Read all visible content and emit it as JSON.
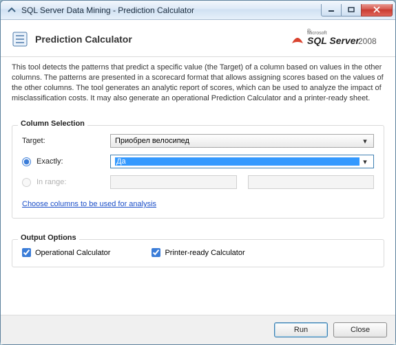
{
  "window": {
    "title": "SQL Server Data Mining - Prediction Calculator"
  },
  "header": {
    "title": "Prediction Calculator",
    "brand_prefix": "Microsoft",
    "brand_main": "SQL Server",
    "brand_year": "2008"
  },
  "description": "This tool detects the patterns that predict a specific value (the Target) of a column based on values in the other columns. The patterns are presented in a scorecard format that allows assigning scores based on the values of the other columns. The tool generates an analytic report of scores, which can be used to analyze the impact of misclassification costs. It may also generate an operational Prediction Calculator and a printer-ready sheet.",
  "column_selection": {
    "legend": "Column Selection",
    "target_label": "Target:",
    "target_value": "Приобрел велосипед",
    "exactly_label": "Exactly:",
    "exactly_value": "Да",
    "exactly_selected": true,
    "in_range_label": "In range:",
    "in_range_selected": false,
    "in_range_enabled": false,
    "choose_columns_link": "Choose columns to be used for analysis"
  },
  "output_options": {
    "legend": "Output Options",
    "operational_label": "Operational Calculator",
    "operational_checked": true,
    "printer_label": "Printer-ready Calculator",
    "printer_checked": true
  },
  "footer": {
    "run_label": "Run",
    "close_label": "Close"
  }
}
